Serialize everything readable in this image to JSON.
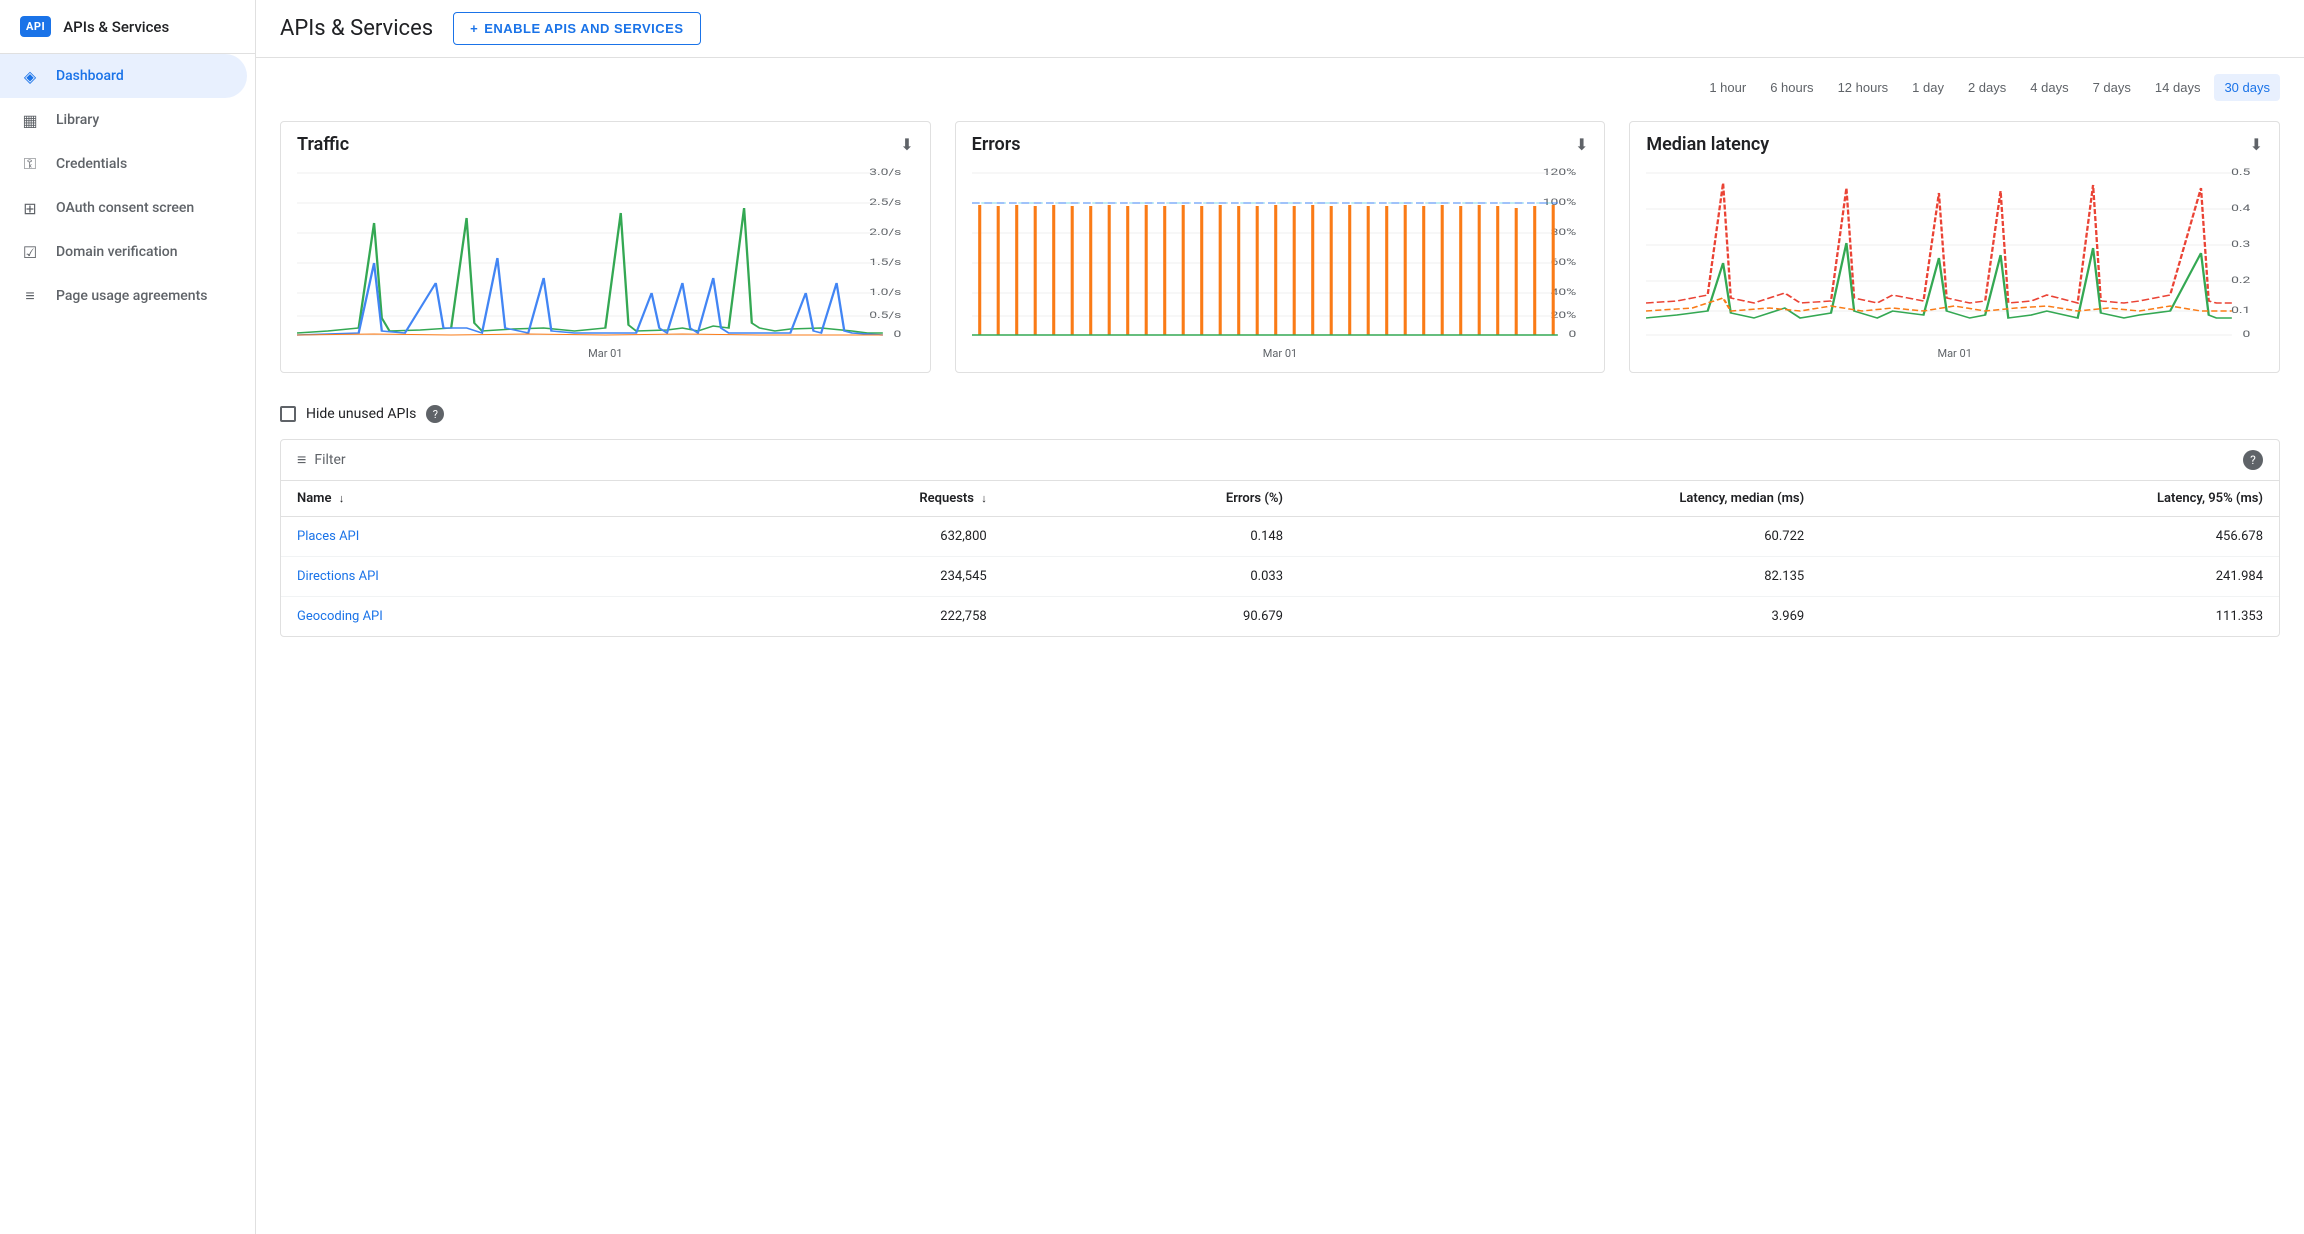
{
  "sidebar": {
    "logo_text": "API",
    "title": "APIs & Services",
    "nav_items": [
      {
        "id": "dashboard",
        "label": "Dashboard",
        "icon": "◈",
        "active": true
      },
      {
        "id": "library",
        "label": "Library",
        "icon": "▦",
        "active": false
      },
      {
        "id": "credentials",
        "label": "Credentials",
        "icon": "⚿",
        "active": false
      },
      {
        "id": "oauth-consent",
        "label": "OAuth consent screen",
        "icon": "⊞",
        "active": false
      },
      {
        "id": "domain-verification",
        "label": "Domain verification",
        "icon": "☑",
        "active": false
      },
      {
        "id": "page-usage",
        "label": "Page usage agreements",
        "icon": "≡",
        "active": false
      }
    ]
  },
  "header": {
    "title": "APIs & Services",
    "enable_btn_label": "ENABLE APIS AND SERVICES",
    "enable_btn_icon": "+"
  },
  "time_filters": {
    "options": [
      {
        "label": "1 hour",
        "active": false
      },
      {
        "label": "6 hours",
        "active": false
      },
      {
        "label": "12 hours",
        "active": false
      },
      {
        "label": "1 day",
        "active": false
      },
      {
        "label": "2 days",
        "active": false
      },
      {
        "label": "4 days",
        "active": false
      },
      {
        "label": "7 days",
        "active": false
      },
      {
        "label": "14 days",
        "active": false
      },
      {
        "label": "30 days",
        "active": true
      }
    ]
  },
  "charts": {
    "traffic": {
      "title": "Traffic",
      "x_label": "Mar 01",
      "y_max": "3.0/s",
      "y_labels": [
        "3.0/s",
        "2.5/s",
        "2.0/s",
        "1.5/s",
        "1.0/s",
        "0.5/s",
        "0"
      ]
    },
    "errors": {
      "title": "Errors",
      "x_label": "Mar 01",
      "y_max": "120%",
      "y_labels": [
        "120%",
        "100%",
        "80%",
        "60%",
        "40%",
        "20%",
        "0"
      ]
    },
    "latency": {
      "title": "Median latency",
      "x_label": "Mar 01",
      "y_max": "0.5",
      "y_labels": [
        "0.5",
        "0.4",
        "0.3",
        "0.2",
        "0.1",
        "0"
      ]
    }
  },
  "hide_unused": {
    "label": "Hide unused APIs",
    "checked": false
  },
  "table": {
    "filter_placeholder": "Filter",
    "columns": [
      {
        "label": "Name",
        "sortable": true
      },
      {
        "label": "Requests",
        "sortable": true
      },
      {
        "label": "Errors (%)",
        "sortable": false
      },
      {
        "label": "Latency, median (ms)",
        "sortable": false
      },
      {
        "label": "Latency, 95% (ms)",
        "sortable": false
      }
    ],
    "rows": [
      {
        "name": "Places API",
        "requests": "632,800",
        "errors": "0.148",
        "latency_median": "60.722",
        "latency_95": "456.678"
      },
      {
        "name": "Directions API",
        "requests": "234,545",
        "errors": "0.033",
        "latency_median": "82.135",
        "latency_95": "241.984"
      },
      {
        "name": "Geocoding API",
        "requests": "222,758",
        "errors": "90.679",
        "latency_median": "3.969",
        "latency_95": "111.353"
      }
    ]
  },
  "colors": {
    "brand_blue": "#1a73e8",
    "active_bg": "#e8f0fe",
    "border": "#e0e0e0",
    "text_primary": "#202124",
    "text_secondary": "#5f6368",
    "chart_blue": "#4285f4",
    "chart_orange": "#fa7b17",
    "chart_green": "#34a853",
    "chart_red": "#ea4335",
    "chart_teal": "#00bcd4"
  }
}
